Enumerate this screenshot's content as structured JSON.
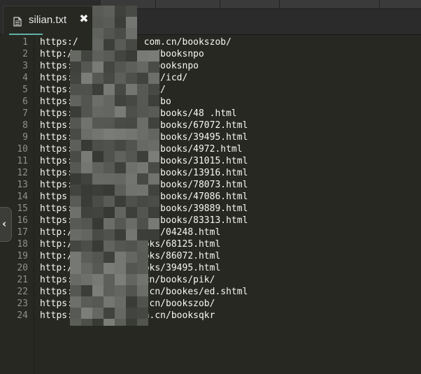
{
  "tab": {
    "title": "silian.txt",
    "file_icon": "file-icon",
    "close_icon": "close-icon"
  },
  "collapse_handle": {
    "glyph": "‹",
    "icon": "chevron-left-icon"
  },
  "lines": [
    {
      "number": "1",
      "text": "https:/            com.cn/bookszob/"
    },
    {
      "number": "2",
      "text": "http:/              n/booksnpo"
    },
    {
      "number": "3",
      "text": "https:/            n/booksnpo"
    },
    {
      "number": "4",
      "text": "https://         books/icd/"
    },
    {
      "number": "5",
      "text": "https://          /gcx/"
    },
    {
      "number": "6",
      "text": "https://           cn/bo"
    },
    {
      "number": "7",
      "text": "https://           cn/books/48 .html"
    },
    {
      "number": "8",
      "text": "https://           cn/books/67072.html"
    },
    {
      "number": "9",
      "text": "https:/            cn/books/39495.html"
    },
    {
      "number": "10",
      "text": "https:/            cn/books/4972.html"
    },
    {
      "number": "11",
      "text": "https:/            cn/books/31015.html"
    },
    {
      "number": "12",
      "text": "https:/            cn/books/13916.html"
    },
    {
      "number": "13",
      "text": "https:/            cn/books/78073.html"
    },
    {
      "number": "14",
      "text": "https              cn/books/47086.html"
    },
    {
      "number": "15",
      "text": "https:             cn/books/39889.html"
    },
    {
      "number": "16",
      "text": "https:/            cn/books/83313.html"
    },
    {
      "number": "17",
      "text": "http:/          /books/04248.html"
    },
    {
      "number": "18",
      "text": "http:/          /books/68125.html"
    },
    {
      "number": "19",
      "text": "http://          books/86072.html"
    },
    {
      "number": "20",
      "text": "http:/          /books/39495.html"
    },
    {
      "number": "21",
      "text": "https:/            cn/books/pik/"
    },
    {
      "number": "22",
      "text": "https:/            .cn/bookes/ed.shtml"
    },
    {
      "number": "23",
      "text": "https://           .cn/bookszob/"
    },
    {
      "number": "24",
      "text": "https://           n.cn/booksqkr"
    }
  ]
}
